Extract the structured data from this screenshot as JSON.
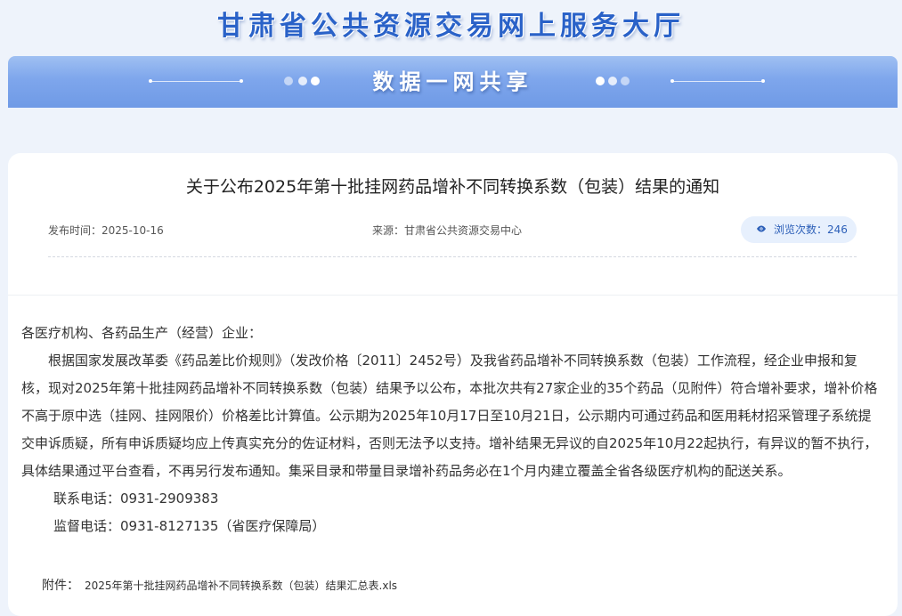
{
  "header": {
    "site_title": "甘肃省公共资源交易网上服务大厅",
    "banner_text": "数据一网共享"
  },
  "article": {
    "title": "关于公布2025年第十批挂网药品增补不同转换系数（包装）结果的通知",
    "publish_time": "发布时间：2025-10-16",
    "source": "来源：甘肃省公共资源交易中心",
    "views": "浏览次数：246",
    "salutation": "各医疗机构、各药品生产（经营）企业：",
    "paragraph": "根据国家发展改革委《药品差比价规则》（发改价格〔2011〕2452号）及我省药品增补不同转换系数（包装）工作流程，经企业申报和复核，现对2025年第十批挂网药品增补不同转换系数（包装）结果予以公布，本批次共有27家企业的35个药品（见附件）符合增补要求，增补价格不高于原中选（挂网、挂网限价）价格差比计算值。公示期为2025年10月17日至10月21日，公示期内可通过药品和医用耗材招采管理子系统提交申诉质疑，所有申诉质疑均应上传真实充分的佐证材料，否则无法予以支持。增补结果无异议的自2025年10月22起执行，有异议的暂不执行，具体结果通过平台查看，不再另行发布通知。集采目录和带量目录增补药品务必在1个月内建立覆盖全省各级医疗机构的配送关系。",
    "contact_phone": "联系电话：0931-2909383",
    "supervise_phone": "监督电话：0931-8127135（省医疗保障局）",
    "attachment_label": "附件：",
    "attachment_file": "2025年第十批挂网药品增补不同转换系数（包装）结果汇总表.xls"
  },
  "colors": {
    "accent": "#2a62c8",
    "banner": "#7ea6ec",
    "views_bg": "#e7f0fd",
    "page_bg": "#eef3fb"
  },
  "icons": {
    "views": "eye-icon"
  }
}
